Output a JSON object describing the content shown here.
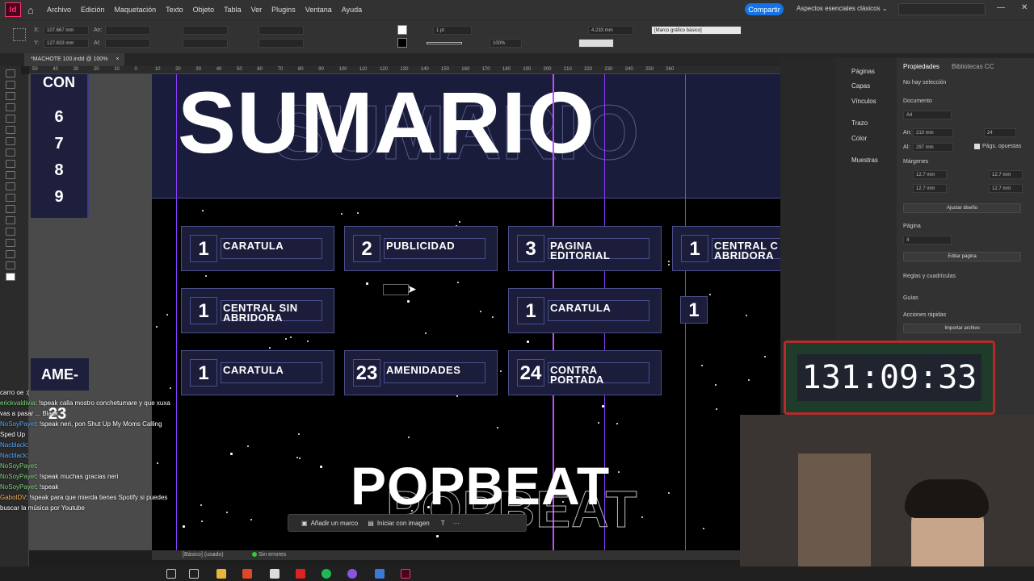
{
  "app": {
    "logo": "Id",
    "home_icon": "home-icon",
    "accent": "#ff3366"
  },
  "menu": [
    "Archivo",
    "Edición",
    "Maquetación",
    "Texto",
    "Objeto",
    "Tabla",
    "Ver",
    "Plugins",
    "Ventana",
    "Ayuda"
  ],
  "header": {
    "share": "Compartir",
    "workspace": "Aspectos esenciales clásicos"
  },
  "control_bar": {
    "x_label": "X:",
    "x_value": "107.667 mm",
    "y_label": "Y:",
    "y_value": "127.833 mm",
    "an_label": "An:",
    "al_label": "Al:",
    "stroke_weight": "1 pt",
    "opacity": "100%",
    "offset": "4.233 mm",
    "style": "[Marco gráfico básico]"
  },
  "doc_tab": {
    "name": "*MACHOTE 100.indd @ 100%",
    "close": "×"
  },
  "ruler": {
    "ticks": [
      "50",
      "40",
      "30",
      "20",
      "10",
      "0",
      "10",
      "20",
      "30",
      "40",
      "50",
      "60",
      "70",
      "80",
      "90",
      "100",
      "110",
      "120",
      "130",
      "140",
      "150",
      "160",
      "170",
      "180",
      "190",
      "200",
      "210",
      "220",
      "230",
      "240",
      "250",
      "260"
    ]
  },
  "left_page": {
    "title": "CON",
    "numbers": [
      "6",
      "7",
      "8",
      "9"
    ],
    "bottom_title": "AME-",
    "bottom_number": "23"
  },
  "page": {
    "title": "SUMARIO",
    "cards": [
      {
        "num": "1",
        "label": "CARATULA"
      },
      {
        "num": "2",
        "label": "PUBLICIDAD"
      },
      {
        "num": "3",
        "label": "PAGINA EDITORIAL"
      },
      {
        "num": "1",
        "label": "CENTRAL C ABRIDORA"
      },
      {
        "num": "1",
        "label": "CENTRAL SIN ABRIDORA"
      },
      {
        "num": "1",
        "label": "CARATULA"
      },
      {
        "num": "1",
        "label": ""
      },
      {
        "num": "1",
        "label": "CARATULA"
      },
      {
        "num": "23",
        "label": "AMENIDADES"
      },
      {
        "num": "24",
        "label": "CONTRA PORTADA"
      }
    ],
    "footer_title": "POPBEAT"
  },
  "float_bar": {
    "add_frame": "Añadir un marco",
    "start_image": "Iniciar con imagen"
  },
  "status_bar": {
    "style": "[Básico] (usado)",
    "errors": "Sin errores"
  },
  "panels": [
    "Páginas",
    "Capas",
    "Vínculos",
    "Trazo",
    "Color",
    "Muestras"
  ],
  "properties": {
    "tabs": [
      "Propiedades",
      "Bibliotecas CC"
    ],
    "no_selection": "No hay selección",
    "document_label": "Documento",
    "paper": "A4",
    "width_label": "An:",
    "width": "210 mm",
    "height_label": "Al:",
    "height": "297 mm",
    "pages": "24",
    "facing": "Págs. opuestas",
    "margins_label": "Márgenes",
    "margin_top": "12.7 mm",
    "margin_bottom": "12.7 mm",
    "margin_left": "12.7 mm",
    "margin_right": "12.7 mm",
    "adjust": "Ajustar diseño",
    "page_label": "Página",
    "page_value": "4",
    "edit_page": "Editar página",
    "rulers_label": "Reglas y cuadrículas",
    "guides_label": "Guías",
    "quick_actions": "Acciones rápidas",
    "import": "Importar archivo"
  },
  "timer": "131:09:33",
  "chat": [
    {
      "user": "",
      "text": "carro oe :("
    },
    {
      "user": "erickvaldivia",
      "text": ": !speak calla mostro conchetumare y que xuxa vas a pasar ... Black"
    },
    {
      "user": "NoSoyPayet",
      "text": ": !speak neri, pon Shut Up My Moms Calling Sped Up"
    },
    {
      "user": "Nacblack",
      "text": ":"
    },
    {
      "user": "Nacblack",
      "text": ":"
    },
    {
      "user": "NoSoyPayet",
      "text": ":"
    },
    {
      "user": "NoSoyPayet",
      "text": ": !speak muchas gracias neri"
    },
    {
      "user": "NoSoyPayet",
      "text": ": !speak"
    },
    {
      "user": "GabolDV",
      "text": ": !speak para que mierda tienes Spotify si puedes buscar la música por Youtube"
    }
  ],
  "colors": {
    "page_band": "#1a1c3c",
    "card_border": "#4a4f8a",
    "guide": "#8a3cff",
    "timer_frame": "#b32b2b"
  }
}
